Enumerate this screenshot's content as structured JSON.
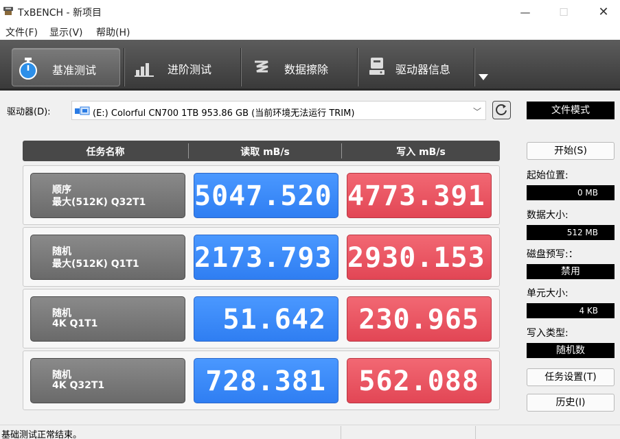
{
  "window": {
    "title": "TxBENCH - 新项目",
    "min_glyph": "—",
    "max_glyph": "☐",
    "close_glyph": "✕"
  },
  "menu": [
    "文件(F)",
    "显示(V)",
    "帮助(H)"
  ],
  "tabs": [
    {
      "label": "基准测试",
      "icon": "stopwatch-icon",
      "active": true
    },
    {
      "label": "进阶测试",
      "icon": "bar-chart-icon",
      "active": false
    },
    {
      "label": "数据擦除",
      "icon": "erase-icon",
      "active": false
    },
    {
      "label": "驱动器信息",
      "icon": "drive-info-icon",
      "active": false
    }
  ],
  "drive": {
    "label": "驱动器(D):",
    "selected": "(E:) Colorful CN700 1TB  953.86 GB (当前环境无法运行 TRIM)",
    "mode_button": "文件模式"
  },
  "table": {
    "headers": [
      "任务名称",
      "读取 mB/s",
      "写入 mB/s"
    ],
    "rows": [
      {
        "line1": "顺序",
        "line2": "最大(512K) Q32T1",
        "read": "5047.520",
        "write": "4773.391"
      },
      {
        "line1": "随机",
        "line2": "最大(512K) Q1T1",
        "read": "2173.793",
        "write": "2930.153"
      },
      {
        "line1": "随机",
        "line2": "4K Q1T1",
        "read": "51.642",
        "write": "230.965"
      },
      {
        "line1": "随机",
        "line2": "4K Q32T1",
        "read": "728.381",
        "write": "562.088"
      }
    ]
  },
  "side": {
    "start_button": "开始(S)",
    "start_pos_label": "起始位置:",
    "start_pos_value": "0 MB",
    "data_size_label": "数据大小:",
    "data_size_value": "512 MB",
    "precondition_label": "磁盘预写:：",
    "precondition_value": "禁用",
    "unit_size_label": "单元大小:",
    "unit_size_value": "4 KB",
    "write_type_label": "写入类型:",
    "write_type_value": "随机数",
    "task_settings_button": "任务设置(T)",
    "history_button": "历史(I)"
  },
  "status": {
    "text": "基础测试正常结束。"
  },
  "colors": {
    "read": "#3a8af8",
    "write": "#ea5461",
    "toolbar": "#4a4a4a"
  }
}
